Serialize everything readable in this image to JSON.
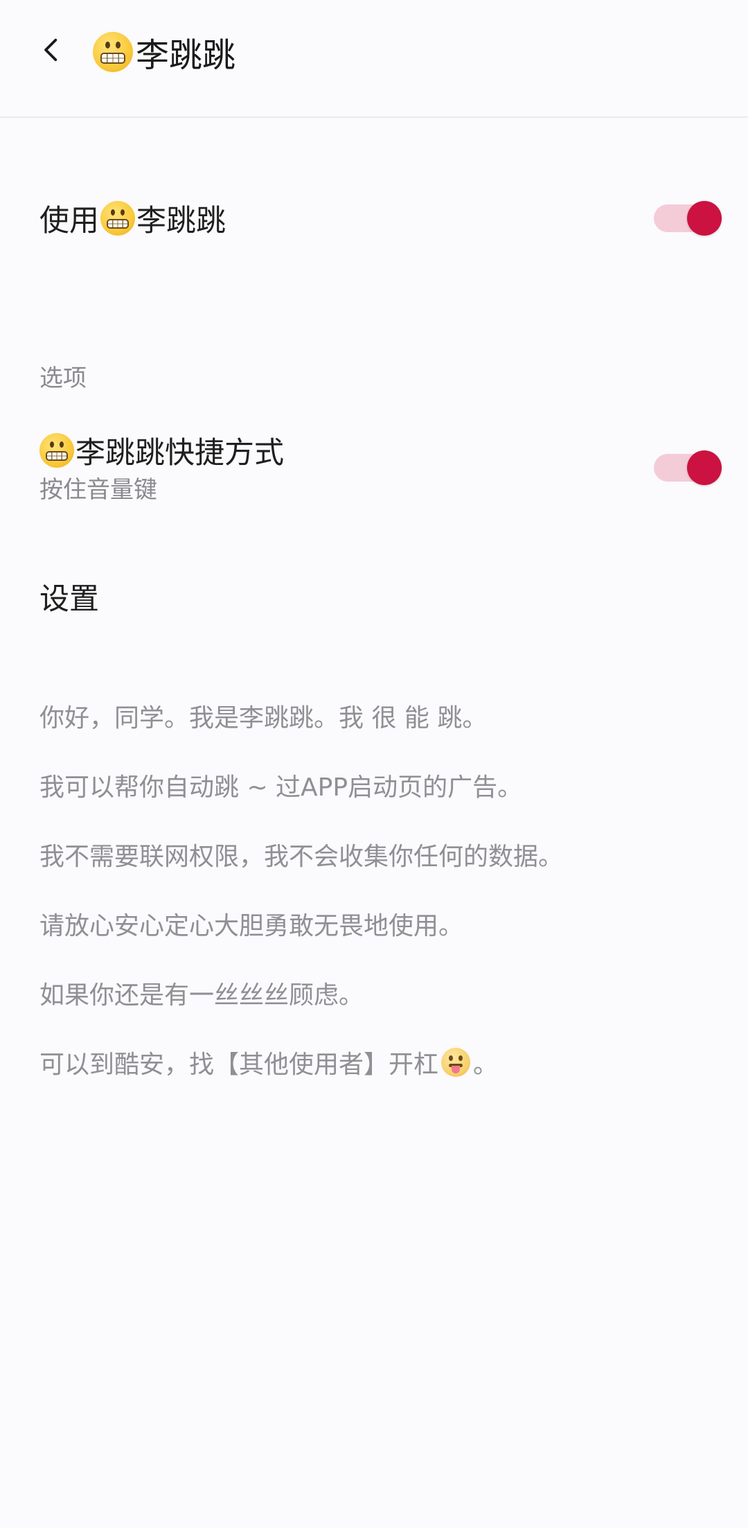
{
  "header": {
    "title": "李跳跳"
  },
  "main_toggle": {
    "prefix": "使用",
    "name": "李跳跳",
    "state": "on"
  },
  "options_section": {
    "header": "选项",
    "shortcut": {
      "name": "李跳跳快捷方式",
      "subtitle": "按住音量键",
      "state": "on"
    }
  },
  "settings": {
    "title": "设置"
  },
  "description": {
    "line1": "你好，同学。我是李跳跳。我 很 能 跳。",
    "line2": "我可以帮你自动跳 ~ 过APP启动页的广告。",
    "line3": "我不需要联网权限，我不会收集你任何的数据。",
    "line4": "请放心安心定心大胆勇敢无畏地使用。",
    "line5": "如果你还是有一丝丝丝顾虑。",
    "line6_before": "可以到酷安，找【其他使用者】开杠",
    "line6_after": "。"
  },
  "colors": {
    "accent": "#cb1240",
    "toggle_track": "#f3ccd7",
    "background": "#fbfafc",
    "secondary_text": "#8a8a8e"
  },
  "icons": {
    "back": "back-arrow-icon",
    "app_emoji": "grimacing-face-icon",
    "tongue_emoji": "tongue-face-icon"
  }
}
